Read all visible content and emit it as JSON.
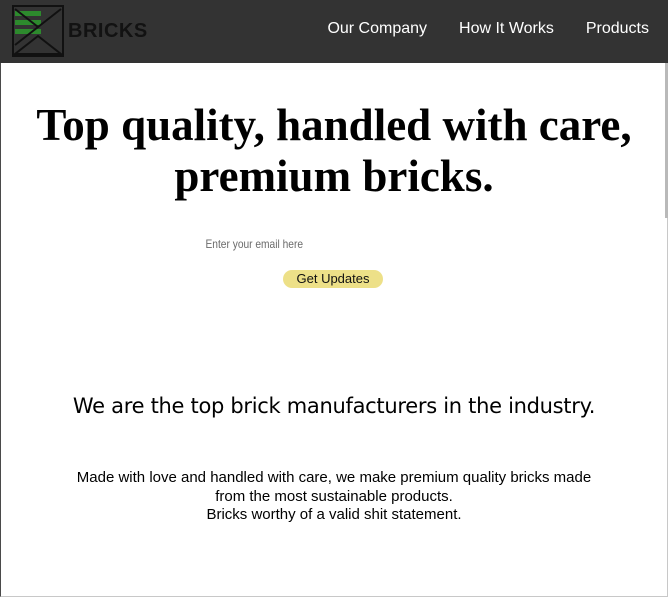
{
  "header": {
    "logo_text": "BRICKS",
    "nav": [
      {
        "label": "Our Company"
      },
      {
        "label": "How It Works"
      },
      {
        "label": "Products"
      }
    ]
  },
  "hero": {
    "title_line1": "Top quality, handled with care,",
    "title_line2": "premium bricks.",
    "email_placeholder": "Enter your email here",
    "button_label": "Get Updates"
  },
  "about": {
    "title": "We are the top brick manufacturers in the industry.",
    "line1": "Made with love and handled with care, we make premium quality bricks made",
    "line2": "from the most sustainable products.",
    "line3": "Bricks worthy of a valid shit statement."
  },
  "colors": {
    "navbar": "#333333",
    "button": "#ede088",
    "logo_green": "#2d8a2d"
  }
}
